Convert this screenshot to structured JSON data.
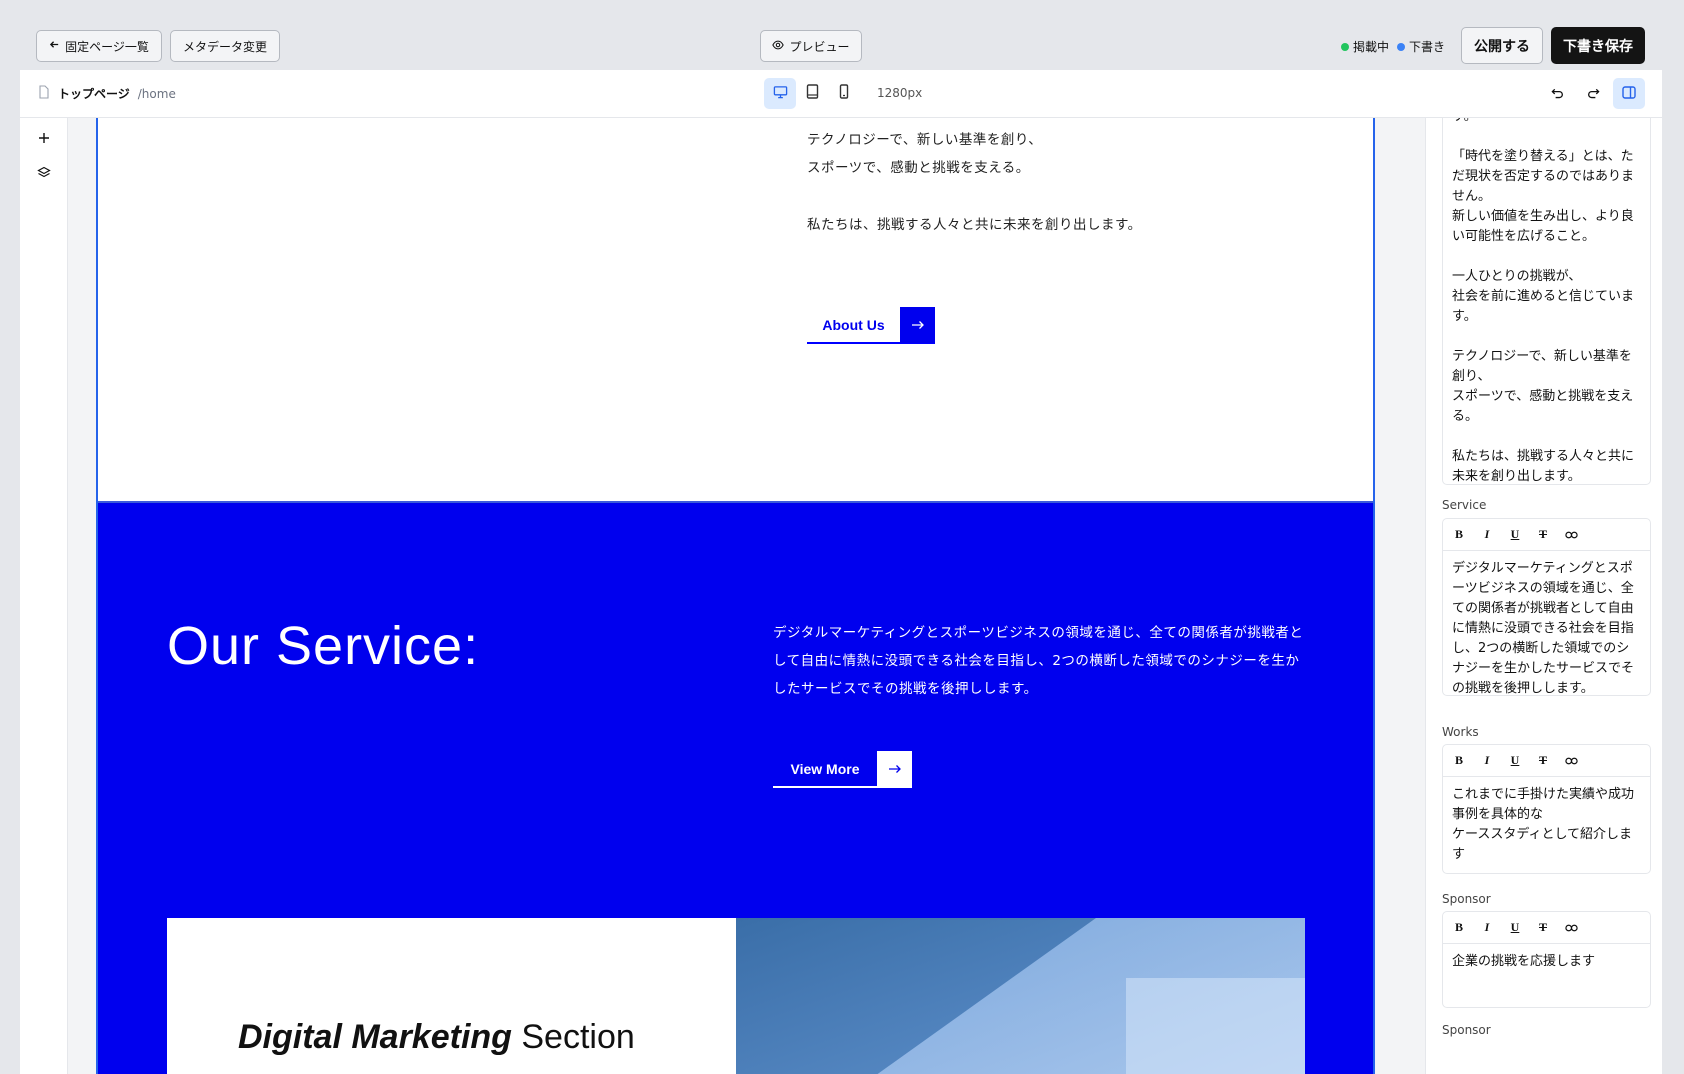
{
  "topbar": {
    "back_label": "固定ページ一覧",
    "meta_label": "メタデータ変更",
    "preview_label": "プレビュー",
    "status_live": "掲載中",
    "status_draft": "下書き",
    "publish_label": "公開する",
    "save_draft_label": "下書き保存",
    "colors": {
      "live": "#22c55e",
      "draft": "#3b82f6"
    }
  },
  "toolbar": {
    "page_name": "トップページ",
    "page_path": "/home",
    "width_label": "1280px",
    "devices": [
      "desktop-icon",
      "tablet-icon",
      "mobile-icon"
    ],
    "active_device": "desktop"
  },
  "canvas": {
    "about": {
      "lines": [
        "テクノロジーで、新しい基準を創り、",
        "スポーツで、感動と挑戦を支える。",
        "私たちは、挑戦する人々と共に未来を創り出します。"
      ],
      "button_label": "About Us"
    },
    "service": {
      "title": "Our Service:",
      "text": "デジタルマーケティングとスポーツビジネスの領域を通じ、全ての関係者が挑戦者として自由に情熱に没頭できる社会を目指し、2つの横断した領域でのシナジーを生かしたサービスでその挑戦を後押しします。",
      "button_label": "View More",
      "card_title_em": "Digital Marketing",
      "card_title_rest": " Section"
    },
    "colors": {
      "brand_blue": "#0000ee"
    }
  },
  "panel": {
    "about_lines": [
      "す。",
      "",
      "「時代を塗り替える」とは、ただ現状を否定するのではありません。",
      "新しい価値を生み出し、より良い可能性を広げること。",
      "",
      "一人ひとりの挑戦が、",
      "社会を前に進めると信じています。",
      "",
      "テクノロジーで、新しい基準を創り、",
      "スポーツで、感動と挑戦を支える。",
      "",
      "私たちは、挑戦する人々と共に未来を創り出します。"
    ],
    "service_label": "Service",
    "service_text": "デジタルマーケティングとスポーツビジネスの領域を通じ、全ての関係者が挑戦者として自由に情熱に没頭できる社会を目指し、2つの横断した領域でのシナジーを生かしたサービスでその挑戦を後押しします。",
    "works_label": "Works",
    "works_lines": [
      "これまでに手掛けた実績や成功事例を具体的な",
      "ケーススタディとして紹介します"
    ],
    "sponsor_label": "Sponsor",
    "sponsor_text": "企業の挑戦を応援します",
    "sponsor2_label": "Sponsor",
    "format_buttons": [
      "B",
      "I",
      "U",
      "S",
      "link-icon"
    ]
  }
}
